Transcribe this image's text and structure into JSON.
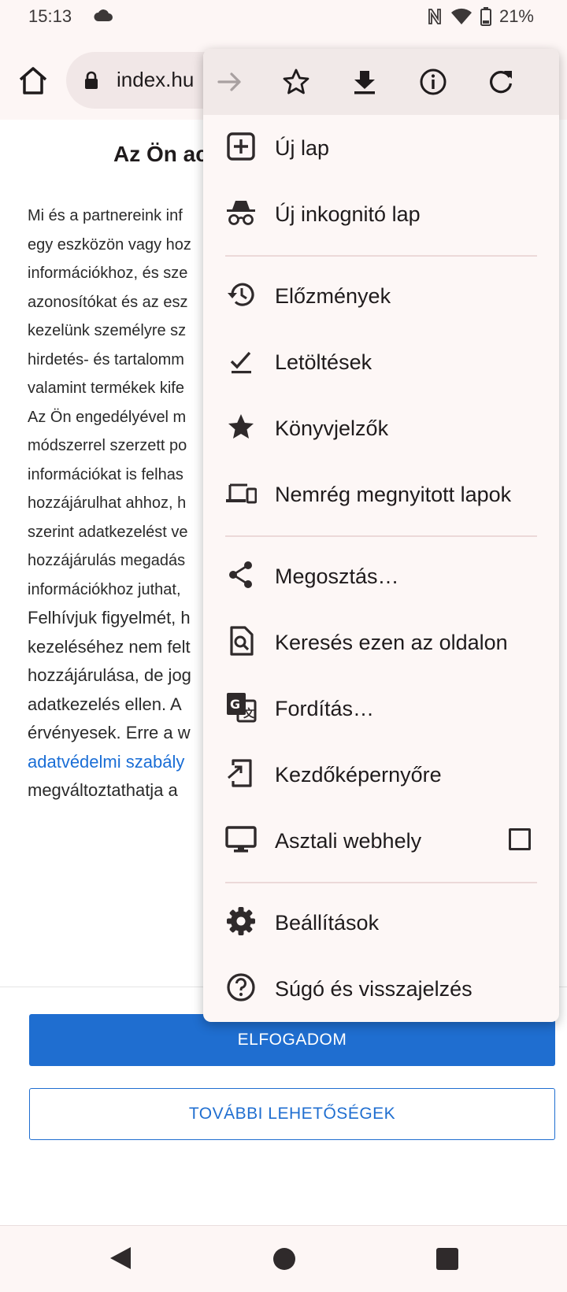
{
  "status": {
    "time": "15:13",
    "battery": "21%"
  },
  "toolbar": {
    "url": "index.hu"
  },
  "page": {
    "title": "Az Ön ac",
    "lines": [
      "Mi és a partnereink inf",
      "egy eszközön vagy hoz",
      "információkhoz, és sze",
      "azonosítókat és az esz",
      "kezelünk személyre sz",
      "hirdetés- és tartalomm",
      "valamint termékek kife",
      "Az Ön engedélyével m",
      "módszerrel szerzett po",
      "információkat is felhas",
      "hozzájárulhat ahhoz, h",
      "szerint adatkezelést ve",
      "hozzájárulás megadás",
      "információkhoz juthat,",
      "Felhívjuk figyelmét, h",
      "kezeléséhez nem felt",
      "hozzájárulása, de jog",
      "adatkezelés ellen. A",
      "érvényesek. Erre a w",
      "adatvédelmi szabály",
      "megváltoztathatja a"
    ],
    "accept_button": "ELFOGADOM",
    "more_button": "TOVÁBBI LEHETŐSÉGEK"
  },
  "menu": {
    "new_tab": "Új lap",
    "incognito": "Új inkognitó lap",
    "history": "Előzmények",
    "downloads": "Letöltések",
    "bookmarks": "Könyvjelzők",
    "recent_tabs": "Nemrég megnyitott lapok",
    "share": "Megosztás…",
    "find": "Keresés ezen az oldalon",
    "translate": "Fordítás…",
    "add_home": "Kezdőképernyőre",
    "desktop_site": "Asztali webhely",
    "desktop_site_checked": false,
    "settings": "Beállítások",
    "help": "Súgó és visszajelzés"
  },
  "colors": {
    "accent": "#1f6ed0",
    "menu_bg": "#fdf7f6",
    "icon": "#2f2a2b"
  }
}
